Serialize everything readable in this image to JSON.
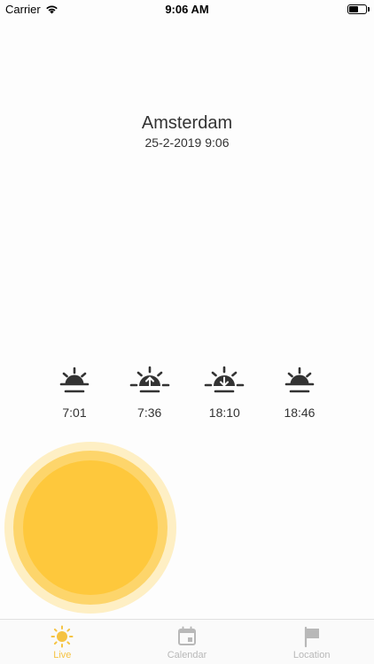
{
  "status_bar": {
    "carrier": "Carrier",
    "time": "9:06 AM"
  },
  "location": {
    "city": "Amsterdam",
    "datetime": "25-2-2019 9:06"
  },
  "sun_events": [
    {
      "icon": "sun-horizon-icon",
      "time": "7:01"
    },
    {
      "icon": "sunrise-icon",
      "time": "7:36"
    },
    {
      "icon": "sunset-icon",
      "time": "18:10"
    },
    {
      "icon": "sun-horizon-icon",
      "time": "18:46"
    }
  ],
  "tabs": [
    {
      "icon": "sun-icon",
      "label": "Live",
      "active": true
    },
    {
      "icon": "calendar-icon",
      "label": "Calendar",
      "active": false
    },
    {
      "icon": "flag-icon",
      "label": "Location",
      "active": false
    }
  ],
  "colors": {
    "accent": "#f5c342",
    "sun_core": "#fec83c",
    "sun_inner_halo": "#fdd56b",
    "sun_outer_halo": "#feefc4",
    "icon_dark": "#333333",
    "tab_inactive": "#b8b8b8"
  }
}
